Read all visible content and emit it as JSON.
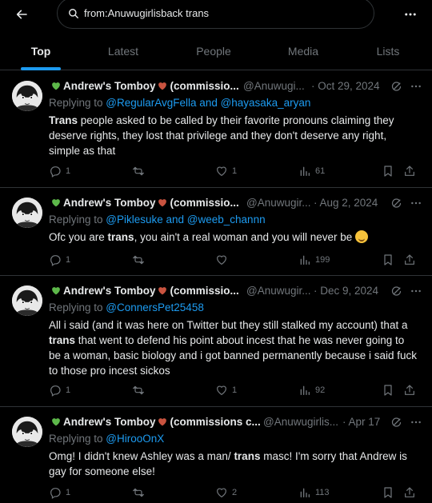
{
  "search": {
    "query": "from:Anuwugirlisback trans"
  },
  "tabs": [
    {
      "label": "Top",
      "active": true
    },
    {
      "label": "Latest",
      "active": false
    },
    {
      "label": "People",
      "active": false
    },
    {
      "label": "Media",
      "active": false
    },
    {
      "label": "Lists",
      "active": false
    }
  ],
  "colors": {
    "accent": "#1d9bf0",
    "heart_green": "#5db84a",
    "heart_red": "#c9533f",
    "muted": "#71767b"
  },
  "icons": [
    "back-arrow-icon",
    "search-icon",
    "more-icon",
    "grok-icon",
    "reply-icon",
    "retweet-icon",
    "like-icon",
    "views-icon",
    "bookmark-icon",
    "share-icon"
  ],
  "tweets": [
    {
      "name": "Andrew's Tomboy",
      "name_suffix": "(commissio...",
      "handle": "@Anuwugi...",
      "date": "· Oct 29, 2024",
      "reply_prefix": "Replying to ",
      "reply_to": "@RegularAvgFella and @hayasaka_aryan",
      "text_bold": "Trans",
      "text_rest": " people asked to be called by their favorite pronouns claiming they deserve rights, they lost that privilege and they don't deserve any right, simple as that",
      "replies": "1",
      "retweets": "",
      "likes": "1",
      "views": "61"
    },
    {
      "name": "Andrew's Tomboy",
      "name_suffix": "(commissio...",
      "handle": "@Anuwugir...",
      "date": "· Aug 2, 2024",
      "reply_prefix": "Replying to ",
      "reply_to": "@Piklesuke and @weeb_channn",
      "text_pre": "Ofc you are ",
      "text_bold": "trans",
      "text_rest": ", you ain't a real woman and you will never be",
      "replies": "1",
      "retweets": "",
      "likes": "",
      "views": "199"
    },
    {
      "name": "Andrew's Tomboy",
      "name_suffix": "(commissio...",
      "handle": "@Anuwugir...",
      "date": "· Dec 9, 2024",
      "reply_prefix": "Replying to ",
      "reply_to": "@ConnersPet25458",
      "text_pre": "All i said (and it was here on Twitter but they still stalked my account) that a ",
      "text_bold": "trans",
      "text_rest": " that went to defend his point about incest that he was never going to be a woman, basic biology and i got banned permanently because i said fuck to those pro incest sickos",
      "replies": "1",
      "retweets": "",
      "likes": "1",
      "views": "92"
    },
    {
      "name": "Andrew's Tomboy",
      "name_suffix": "(commissions c...",
      "handle": "@Anuwugirlis...",
      "date": "· Apr 17",
      "reply_prefix": "Replying to ",
      "reply_to": "@HirooOnX",
      "text_pre": "Omg! I didn't knew Ashley was a man/ ",
      "text_bold": "trans",
      "text_rest": " masc! I'm sorry that Andrew is gay for someone else!",
      "replies": "1",
      "retweets": "",
      "likes": "2",
      "views": "113"
    }
  ]
}
